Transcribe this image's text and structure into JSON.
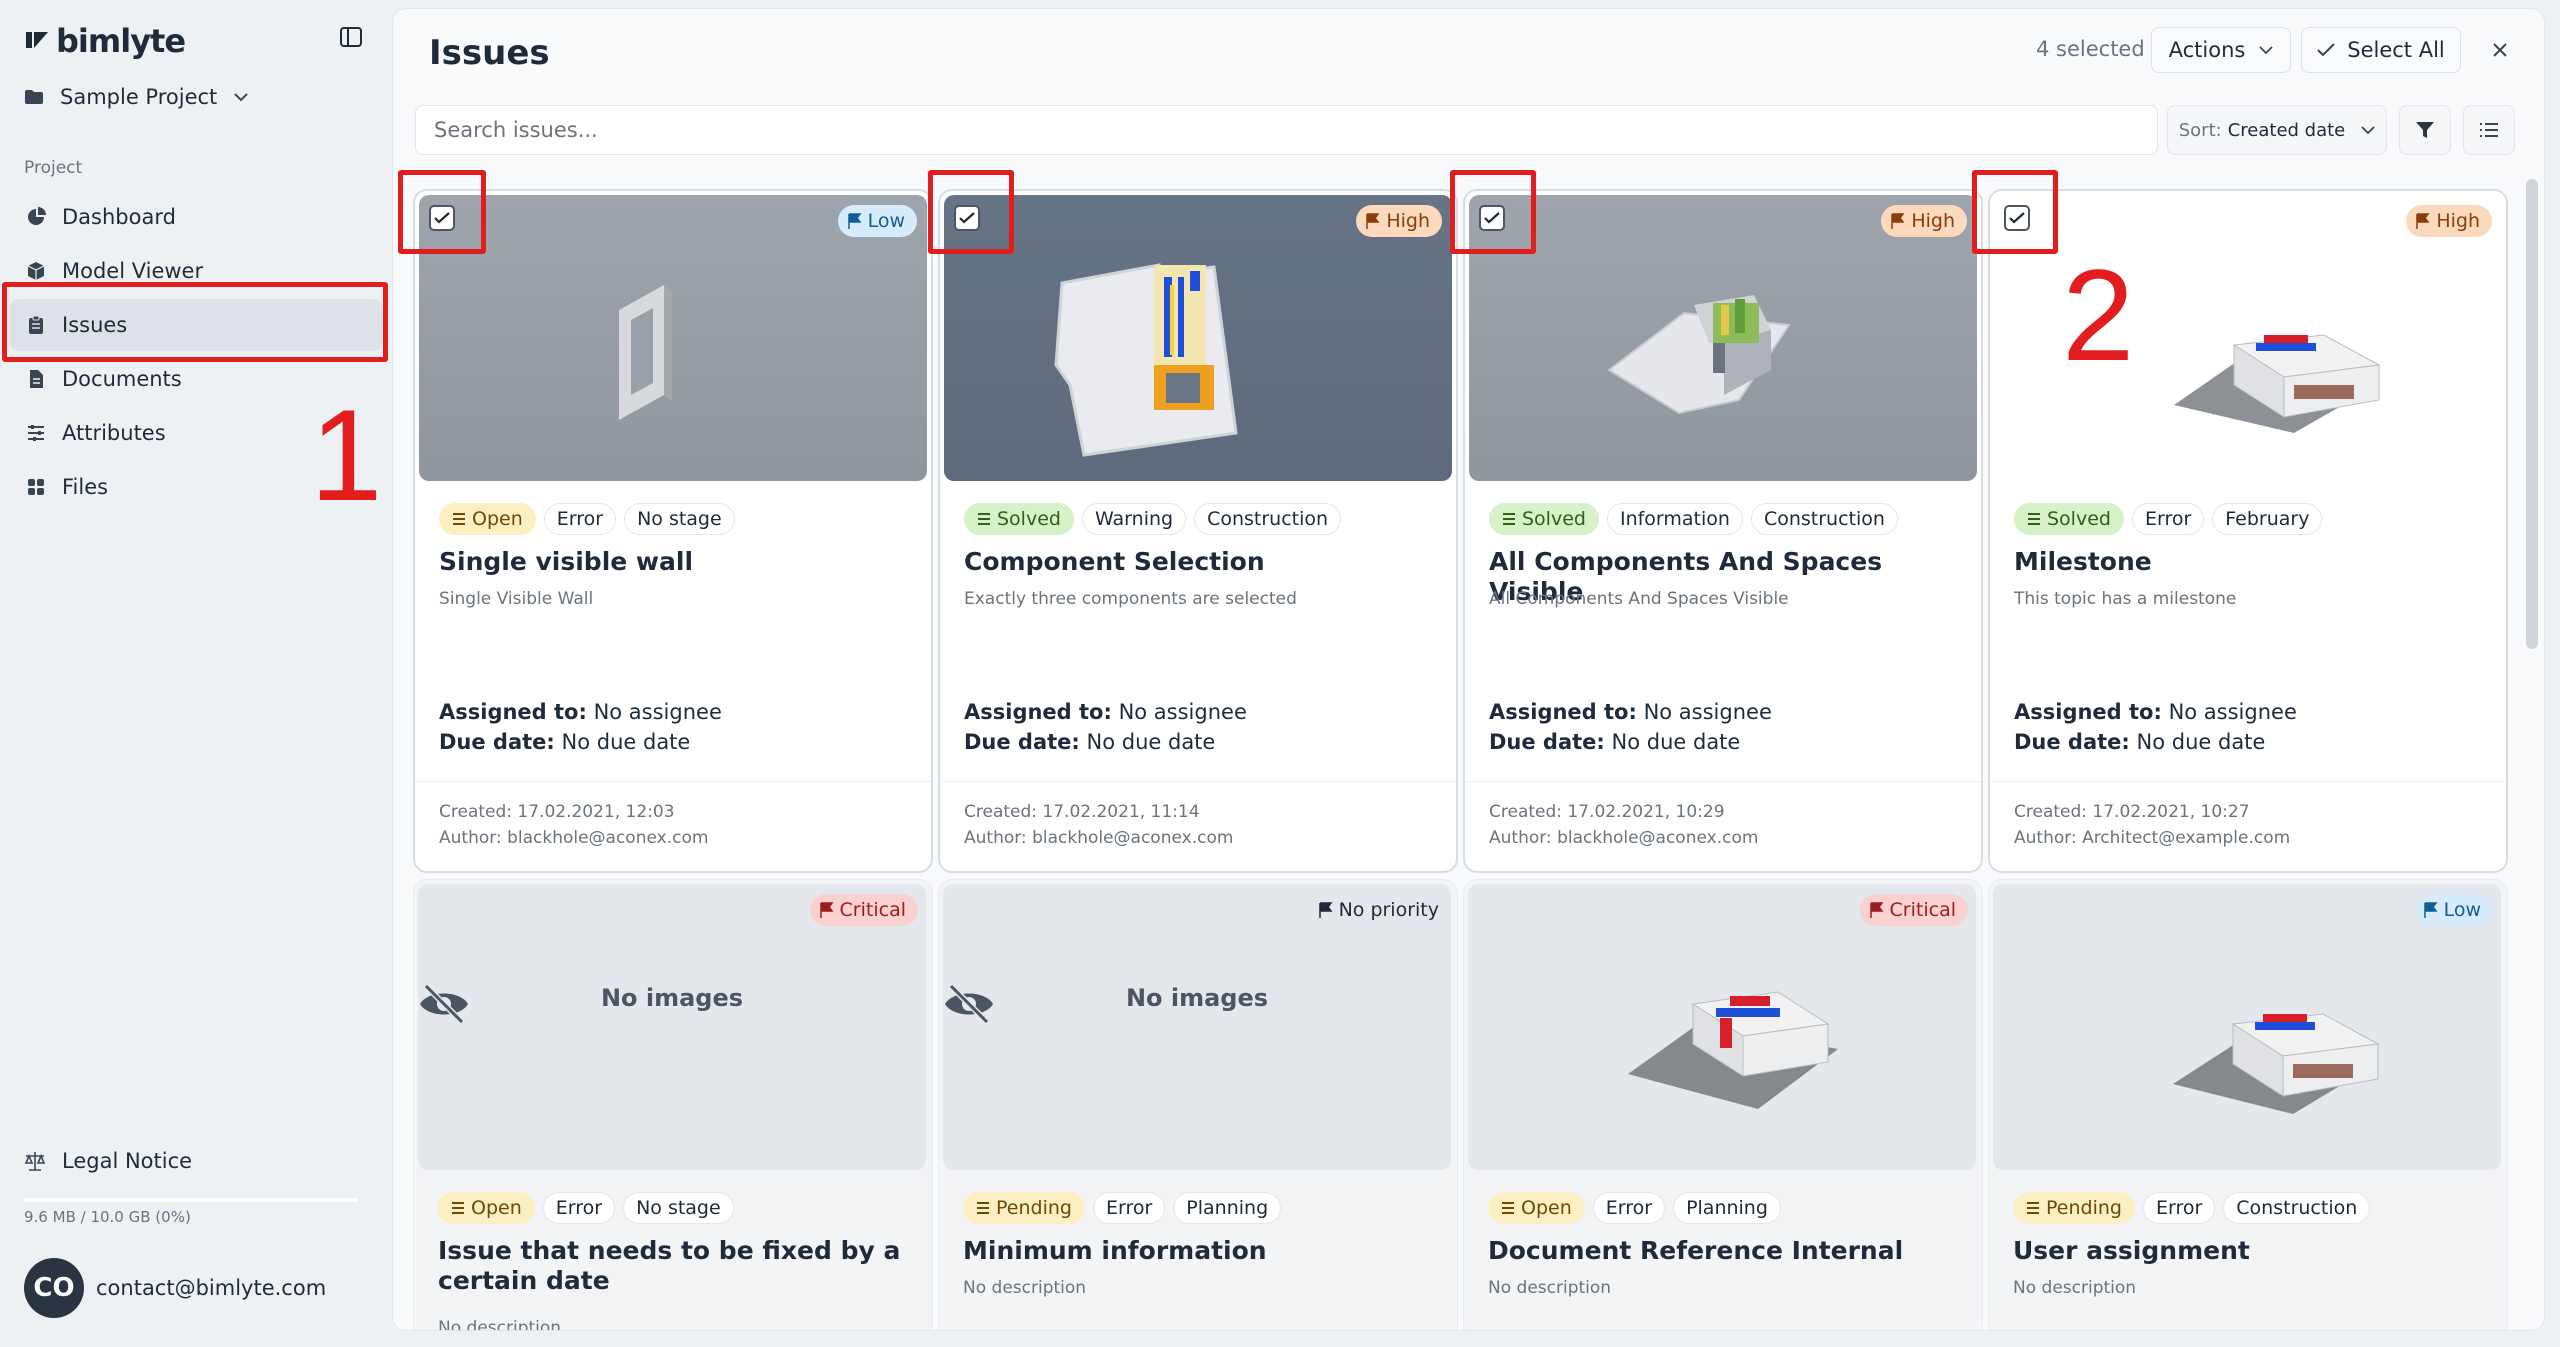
{
  "app": {
    "logo": "bimlyte"
  },
  "sidebar": {
    "project": "Sample Project",
    "section_label": "Project",
    "items": [
      {
        "label": "Dashboard",
        "icon": "pie-chart-icon"
      },
      {
        "label": "Model Viewer",
        "icon": "cube-icon"
      },
      {
        "label": "Issues",
        "icon": "clipboard-icon"
      },
      {
        "label": "Documents",
        "icon": "document-icon"
      },
      {
        "label": "Attributes",
        "icon": "sliders-icon"
      },
      {
        "label": "Files",
        "icon": "grid-icon"
      }
    ],
    "active_item": "Issues",
    "legal": "Legal Notice",
    "storage": "9.6 MB / 10.0 GB (0%)",
    "storage_percent": 0,
    "user": {
      "initials": "CO",
      "email": "contact@bimlyte.com"
    }
  },
  "header": {
    "title": "Issues",
    "selected_count": "4 selected",
    "actions_label": "Actions",
    "select_all_label": "Select All"
  },
  "toolbar": {
    "search_placeholder": "Search issues...",
    "sort_label": "Sort:",
    "sort_value": "Created date"
  },
  "labels": {
    "assigned": "Assigned to:",
    "due": "Due date:",
    "no_images": "No images"
  },
  "cards": [
    {
      "selected": true,
      "priority": "Low",
      "status": "Open",
      "type": "Error",
      "stage": "No stage",
      "title": "Single visible wall",
      "description": "Single Visible Wall",
      "assignee": "No assignee",
      "due": "No due date",
      "created": "Created: 17.02.2021, 12:03",
      "author": "Author: blackhole@aconex.com"
    },
    {
      "selected": true,
      "priority": "High",
      "status": "Solved",
      "type": "Warning",
      "stage": "Construction",
      "title": "Component Selection",
      "description": "Exactly three components are selected",
      "assignee": "No assignee",
      "due": "No due date",
      "created": "Created: 17.02.2021, 11:14",
      "author": "Author: blackhole@aconex.com"
    },
    {
      "selected": true,
      "priority": "High",
      "status": "Solved",
      "type": "Information",
      "stage": "Construction",
      "title": "All Components And Spaces Visible",
      "description": "All Components And Spaces Visible",
      "assignee": "No assignee",
      "due": "No due date",
      "created": "Created: 17.02.2021, 10:29",
      "author": "Author: blackhole@aconex.com"
    },
    {
      "selected": true,
      "priority": "High",
      "status": "Solved",
      "type": "Error",
      "stage": "February",
      "title": "Milestone",
      "description": "This topic has a milestone",
      "assignee": "No assignee",
      "due": "No due date",
      "created": "Created: 17.02.2021, 10:27",
      "author": "Author: Architect@example.com"
    },
    {
      "selected": false,
      "priority": "Critical",
      "status": "Open",
      "type": "Error",
      "stage": "No stage",
      "title": "Issue that needs to be fixed by a certain date",
      "description": "No description"
    },
    {
      "selected": false,
      "priority": "No priority",
      "status": "Pending",
      "type": "Error",
      "stage": "Planning",
      "title": "Minimum information",
      "description": "No description"
    },
    {
      "selected": false,
      "priority": "Critical",
      "status": "Open",
      "type": "Error",
      "stage": "Planning",
      "title": "Document Reference Internal",
      "description": "No description"
    },
    {
      "selected": false,
      "priority": "Low",
      "status": "Pending",
      "type": "Error",
      "stage": "Construction",
      "title": "User assignment",
      "description": "No description"
    }
  ],
  "annotations": {
    "one": "1",
    "two": "2"
  },
  "colors": {
    "annotation_red": "#e11d1d",
    "low": "#d6ecfb",
    "high": "#fbd9bd",
    "critical": "#f9d1d1",
    "open": "#fcf0c3",
    "solved": "#d6f2c7"
  }
}
